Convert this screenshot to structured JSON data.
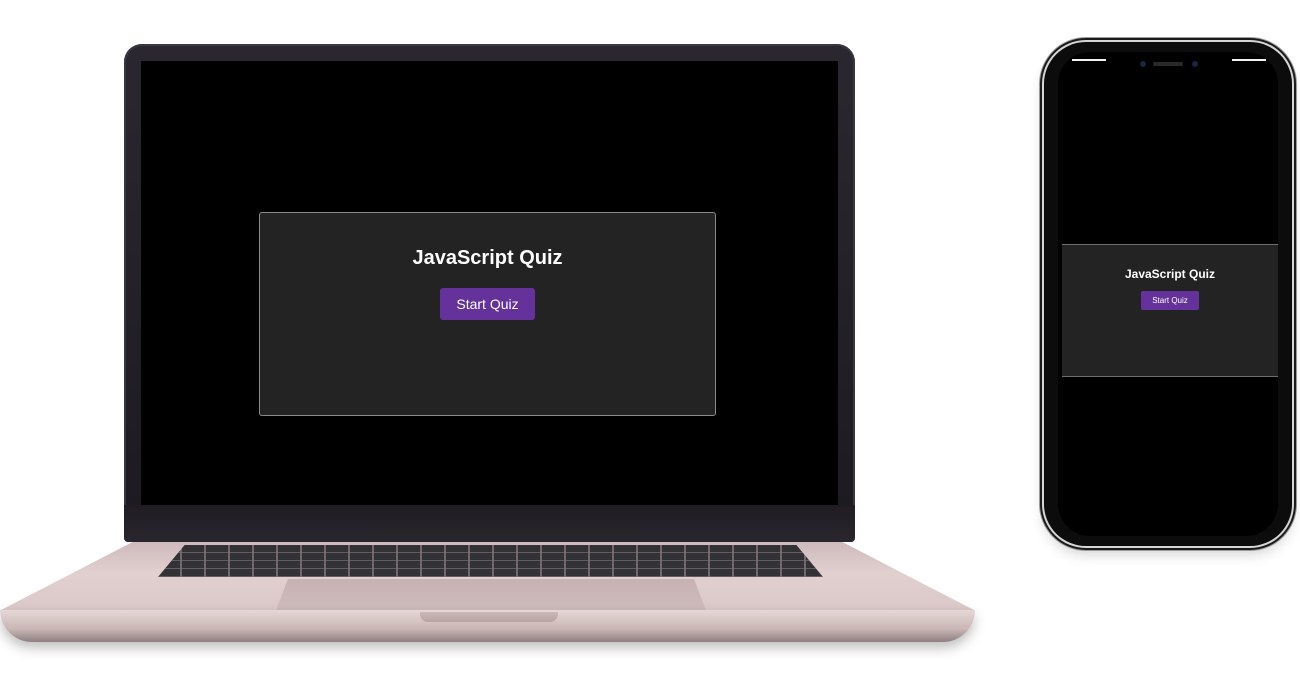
{
  "laptop": {
    "quiz": {
      "title": "JavaScript Quiz",
      "start_button_label": "Start Quiz"
    }
  },
  "phone": {
    "quiz": {
      "title": "JavaScript Quiz",
      "start_button_label": "Start Quiz"
    }
  },
  "colors": {
    "screen_background": "#000000",
    "card_background": "#232323",
    "card_border": "#8a8a8a",
    "button_background": "#64329a",
    "text": "#ffffff"
  }
}
